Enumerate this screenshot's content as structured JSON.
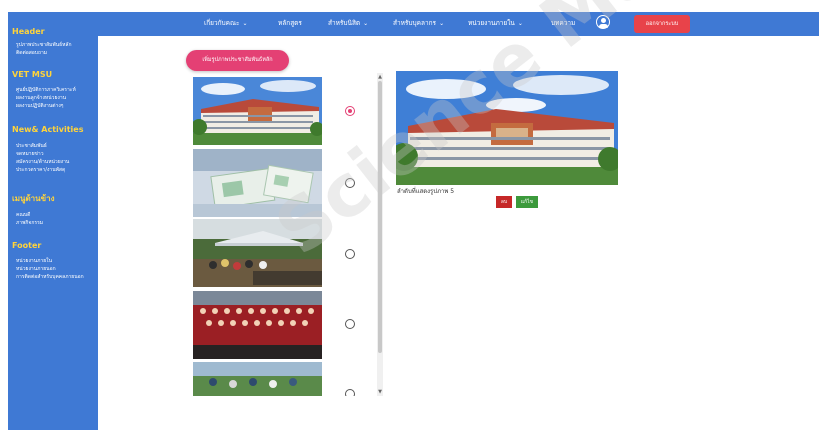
{
  "nav": {
    "items": [
      {
        "label": "เกี่ยวกับคณะ",
        "chevron": true
      },
      {
        "label": "หลักสูตร",
        "chevron": false
      },
      {
        "label": "สำหรับนิสิต",
        "chevron": true
      },
      {
        "label": "สำหรับบุคลากร",
        "chevron": true
      },
      {
        "label": "หน่วยงานภายใน",
        "chevron": true
      },
      {
        "label": "บทความ",
        "chevron": false
      }
    ],
    "logout_label": "ออกจากระบบ",
    "user_icon": "user-circle-icon"
  },
  "sidebar": {
    "sections": [
      {
        "heading": "Header",
        "links": [
          "รูปภาพประชาสัมพันธ์หลัก",
          "ติดต่อสอบถาม"
        ]
      },
      {
        "heading": "VET MSU",
        "links": [
          "ศูนย์ปฏิบัติการภาควิเคราะห์",
          "ผลงานลูกจ้างหน่วยงาน",
          "ผลงานปฏิบัติงานต่างๆ"
        ]
      },
      {
        "heading": "New& Activities",
        "links": [
          "ประชาสัมพันธ์",
          "จดหมายข่าว",
          "สมัครงาน/ด้านหน่วยงาน",
          "ประกวดราคา/งานพัสดุ"
        ]
      },
      {
        "heading": "เมนูด้านข้าง",
        "links": [
          "คณบดี",
          "ภาพกิจกรรม"
        ]
      },
      {
        "heading": "Footer",
        "links": [
          "หน่วยงานภายใน",
          "หน่วยงานภายนอก",
          "การติดต่อสำหรับบุคคลภายนอก"
        ]
      }
    ]
  },
  "main": {
    "add_button_label": "เพิ่มรูปภาพประชาสัมพันธ์หลัก",
    "images": [
      {
        "selected": true
      },
      {
        "selected": false
      },
      {
        "selected": false
      },
      {
        "selected": false
      },
      {
        "selected": false
      }
    ],
    "preview_caption": "ลำดับที่แสดงรูปภาพ 5",
    "delete_label": "ลบ",
    "edit_label": "แก้ไข"
  },
  "watermark": "Science Mahasarakham Uni"
}
